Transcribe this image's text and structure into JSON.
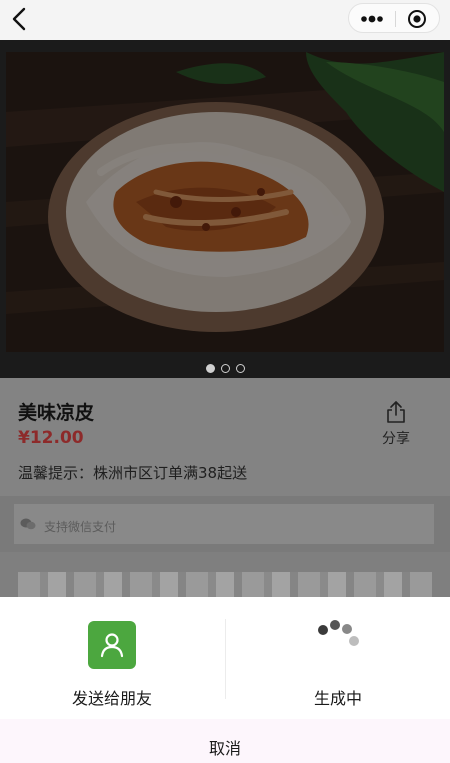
{
  "product": {
    "title": "美味凉皮",
    "price": "¥12.00",
    "share_label": "分享",
    "notice": "温馨提示：株洲市区订单满38起送"
  },
  "carousel": {
    "slides": 3,
    "active_index": 0
  },
  "payment": {
    "text": "支持微信支付"
  },
  "share_sheet": {
    "send_label": "发送给朋友",
    "generating_label": "生成中",
    "cancel_label": "取消"
  },
  "colors": {
    "accent_green": "#4ca73f",
    "price_red": "#8d2a2a"
  }
}
